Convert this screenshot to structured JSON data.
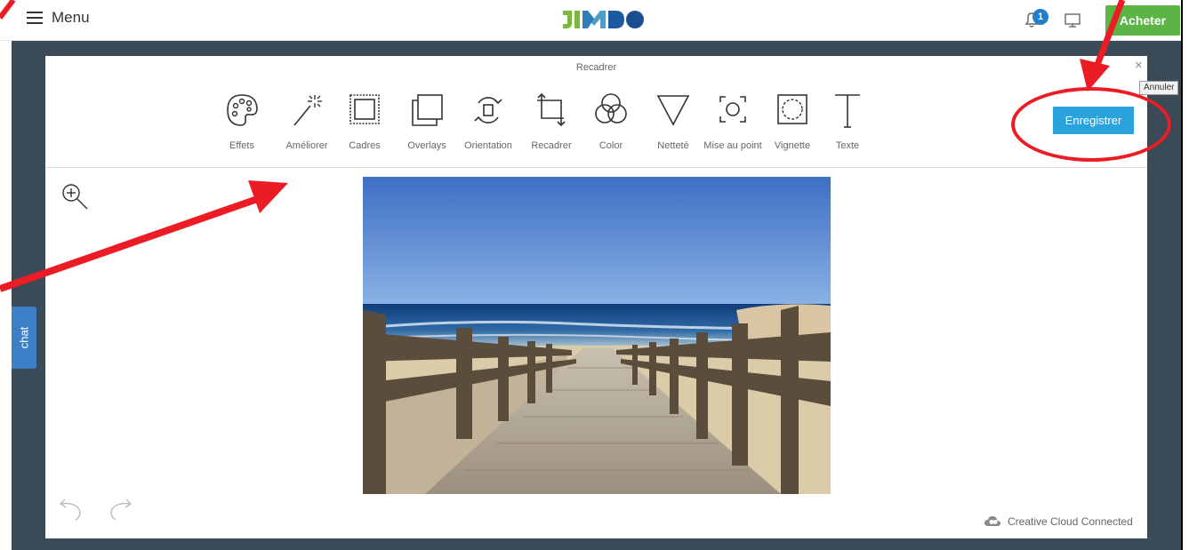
{
  "topbar": {
    "menu_label": "Menu",
    "logo_text": "JIMDO",
    "notification_count": "1",
    "buy_label": "Acheter"
  },
  "editor": {
    "title": "Recadrer",
    "close_symbol": "×",
    "save_label": "Enregistrer",
    "cancel_tooltip": "Annuler",
    "tools": [
      {
        "label": "Effets",
        "icon": "palette-icon"
      },
      {
        "label": "Améliorer",
        "icon": "magic-wand-icon"
      },
      {
        "label": "Cadres",
        "icon": "frame-icon"
      },
      {
        "label": "Overlays",
        "icon": "overlays-icon"
      },
      {
        "label": "Orientation",
        "icon": "rotate-icon"
      },
      {
        "label": "Recadrer",
        "icon": "crop-icon"
      },
      {
        "label": "Color",
        "icon": "color-circles-icon"
      },
      {
        "label": "Netteté",
        "icon": "sharpness-triangle-icon"
      },
      {
        "label": "Mise au point",
        "icon": "focus-icon"
      },
      {
        "label": "Vignette",
        "icon": "vignette-icon"
      },
      {
        "label": "Texte",
        "icon": "text-icon"
      }
    ],
    "footer_text": "Creative Cloud Connected"
  },
  "chat": {
    "label": "chat"
  },
  "colors": {
    "backdrop": "#3b4a57",
    "save": "#2aa3dd",
    "buy": "#5bb545",
    "annotation": "#ec1c24",
    "chat": "#3d7fc6"
  }
}
